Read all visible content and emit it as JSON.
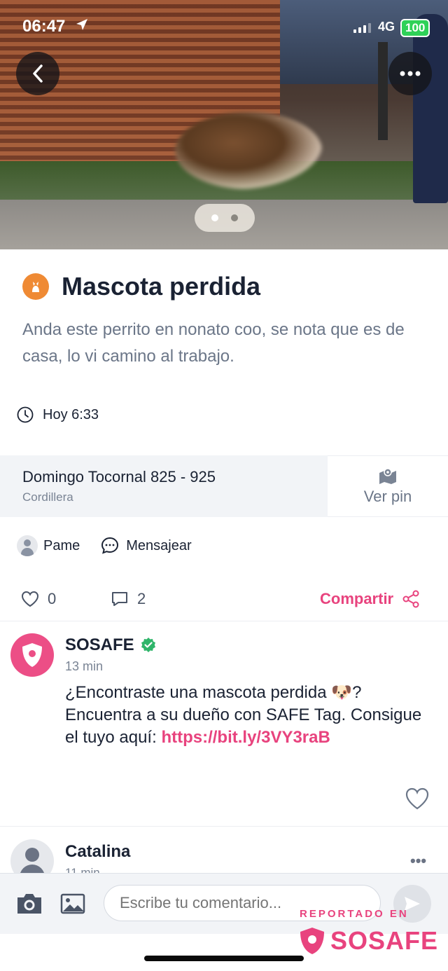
{
  "status_bar": {
    "time": "06:47",
    "network": "4G",
    "battery": "100"
  },
  "post": {
    "title": "Mascota perdida",
    "description": "Anda este perrito en nonato coo, se nota que es de casa, lo vi camino al trabajo.",
    "time": "Hoy 6:33",
    "address": {
      "street": "Domingo Tocornal  825 - 925",
      "city": "Cordillera",
      "pin_label": "Ver pin"
    },
    "author": "Pame",
    "message_label": "Mensajear",
    "likes": "0",
    "comments": "2",
    "share_label": "Compartir"
  },
  "comments": [
    {
      "author": "SOSAFE",
      "time": "13 min",
      "text": "¿Encontraste una mascota perdida 🐶? Encuentra a su dueño con SAFE Tag. Consigue el tuyo aquí: ",
      "link": "https://bit.ly/3VY3raB"
    },
    {
      "author": "Catalina",
      "time": "11 min"
    }
  ],
  "composer": {
    "placeholder": "Escribe tu comentario..."
  },
  "watermark": {
    "top": "REPORTADO EN",
    "brand": "SOSAFE"
  },
  "colors": {
    "accent": "#e8437e",
    "category": "#ef8a34",
    "verified": "#2fb56a"
  }
}
